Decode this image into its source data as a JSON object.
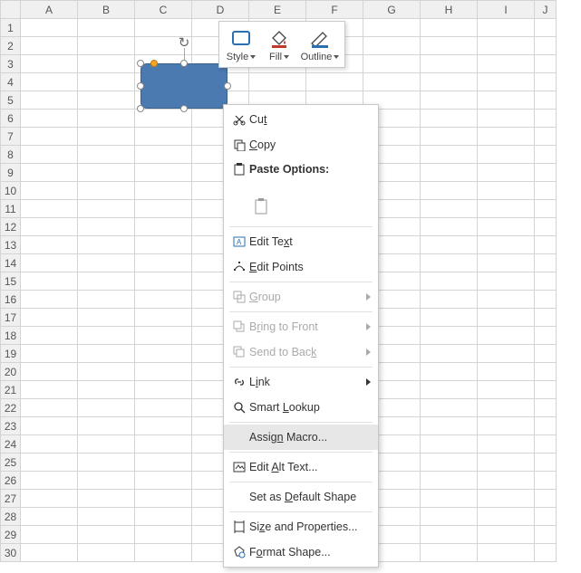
{
  "columns": [
    "A",
    "B",
    "C",
    "D",
    "E",
    "F",
    "G",
    "H",
    "I",
    "J"
  ],
  "rows": [
    "1",
    "2",
    "3",
    "4",
    "5",
    "6",
    "7",
    "8",
    "9",
    "10",
    "11",
    "12",
    "13",
    "14",
    "15",
    "16",
    "17",
    "18",
    "19",
    "20",
    "21",
    "22",
    "23",
    "24",
    "25",
    "26",
    "27",
    "28",
    "29",
    "30"
  ],
  "miniToolbar": {
    "style": "Style",
    "fill": "Fill",
    "outline": "Outline"
  },
  "contextMenu": {
    "cut": "Cut",
    "copy": "Copy",
    "pasteOptions": "Paste Options:",
    "editText": "Edit Text",
    "editPoints": "Edit Points",
    "group": "Group",
    "bringToFront": "Bring to Front",
    "sendToBack": "Send to Back",
    "link": "Link",
    "smartLookup": "Smart Lookup",
    "assignMacro": "Assign Macro...",
    "editAltText": "Edit Alt Text...",
    "setAsDefault": "Set as Default Shape",
    "sizeAndProperties": "Size and Properties...",
    "formatShape": "Format Shape..."
  },
  "accel": {
    "cut": "t",
    "copy": "C",
    "editText": "X",
    "editPoints": "E",
    "group": "G",
    "bringToFront": "R",
    "sendToBack": "K",
    "link": "I",
    "smartLookup": "L",
    "assignMacro": "N",
    "editAltText": "A",
    "setAsDefault": "D",
    "sizeAndProperties": "Z",
    "formatShape": "O"
  }
}
